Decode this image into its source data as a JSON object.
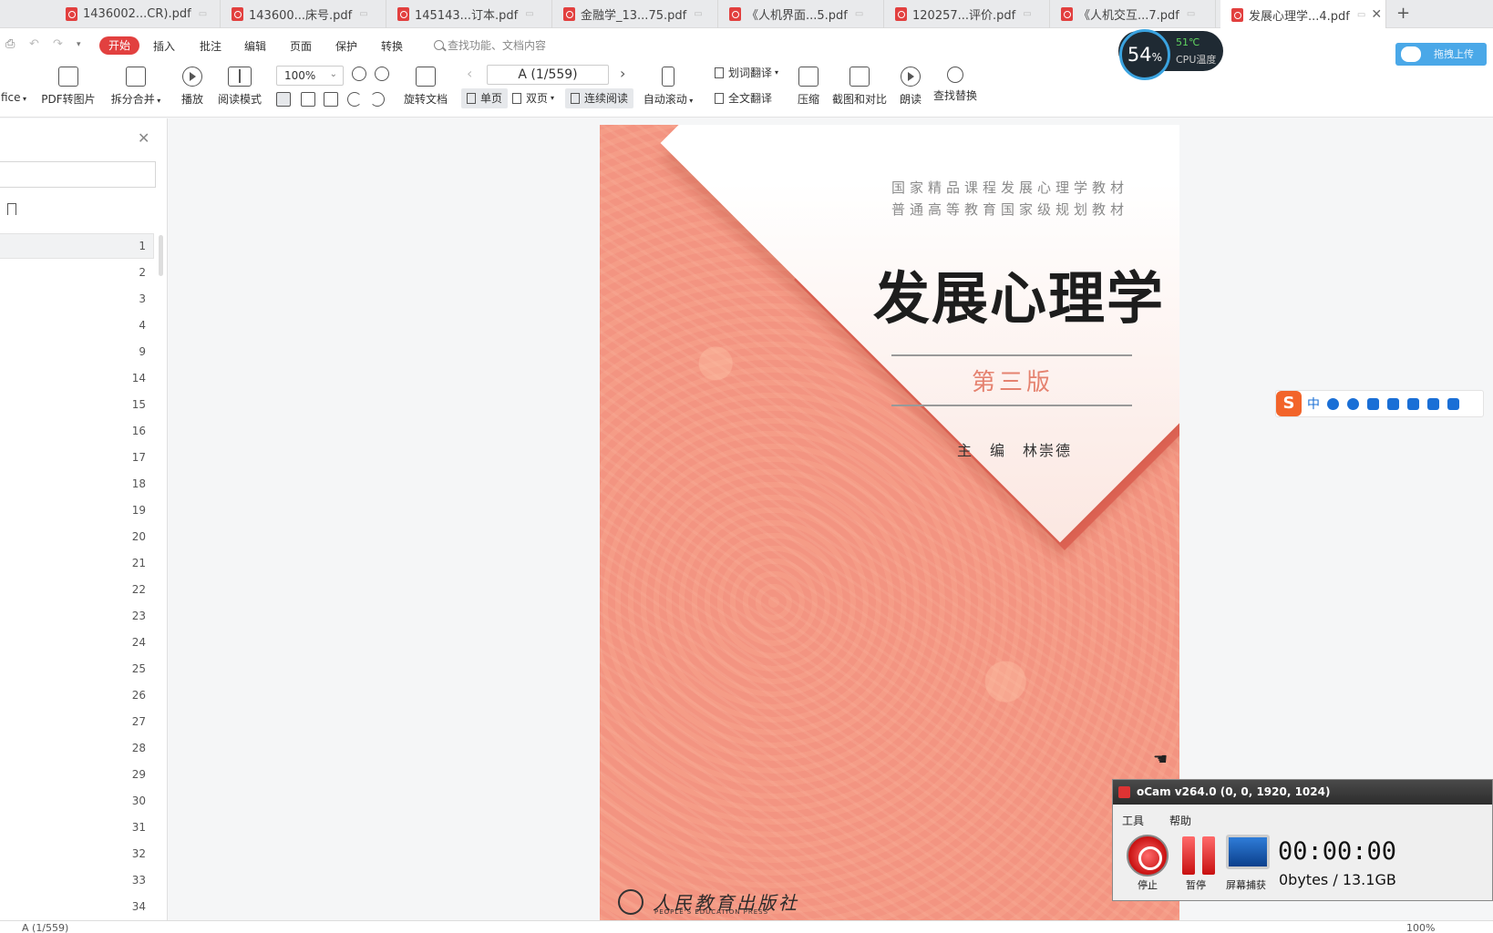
{
  "tabs": [
    {
      "label": "1436002...CR).pdf"
    },
    {
      "label": "143600...床号.pdf"
    },
    {
      "label": "145143...订本.pdf"
    },
    {
      "label": "金融学_13...75.pdf"
    },
    {
      "label": "《人机界面...5.pdf"
    },
    {
      "label": "120257...评价.pdf"
    },
    {
      "label": "《人机交互...7.pdf"
    },
    {
      "label": "发展心理学...4.pdf"
    }
  ],
  "new_tab": "+",
  "menu": {
    "start": "开始",
    "insert": "插入",
    "annotate": "批注",
    "edit": "编辑",
    "page": "页面",
    "protect": "保护",
    "convert": "转换",
    "search_placeholder": "查找功能、文档内容"
  },
  "toolbar": {
    "office": "fice",
    "pdf_to_image": "PDF转图片",
    "split_merge": "拆分合并",
    "play": "播放",
    "read_mode": "阅读模式",
    "zoom": "100%",
    "rotate_doc": "旋转文档",
    "page_indicator": "A (1/559)",
    "single_page": "单页",
    "double_page": "双页",
    "continuous": "连续阅读",
    "auto_scroll": "自动滚动",
    "word_translate": "划词翻译",
    "full_translate": "全文翻译",
    "compress": "压缩",
    "screenshot_compare": "截图和对比",
    "read_aloud": "朗读",
    "find_replace": "查找替换"
  },
  "cpu_widget": {
    "percent": "54",
    "percent_sign": "%",
    "temp": "51℃",
    "label": "CPU温度"
  },
  "upload": {
    "label": "拖拽上传"
  },
  "sidebar": {
    "page_numbers": [
      "1",
      "2",
      "3",
      "4",
      "9",
      "14",
      "15",
      "16",
      "17",
      "18",
      "19",
      "20",
      "21",
      "22",
      "23",
      "24",
      "25",
      "26",
      "27",
      "28",
      "29",
      "30",
      "31",
      "32",
      "33",
      "34"
    ]
  },
  "cover": {
    "series_line1": "国家精品课程发展心理学教材",
    "series_line2": "普通高等教育国家级规划教材",
    "title": "发展心理学",
    "edition": "第三版",
    "editor": "主　编　林崇德",
    "publisher_cn": "人民教育出版社",
    "publisher_en": "PEOPLE'S EDUCATION PRESS"
  },
  "ime": {
    "logo": "S",
    "mode": "中"
  },
  "ocam": {
    "title": "oCam v264.0 (0, 0, 1920, 1024)",
    "menu_tools": "工具",
    "menu_help": "帮助",
    "stop": "停止",
    "pause": "暂停",
    "capture": "屏幕捕获",
    "time": "00:00:00",
    "size": "0bytes / 13.1GB"
  },
  "statusbar": {
    "page": "A (1/559)",
    "zoom": "100%"
  }
}
